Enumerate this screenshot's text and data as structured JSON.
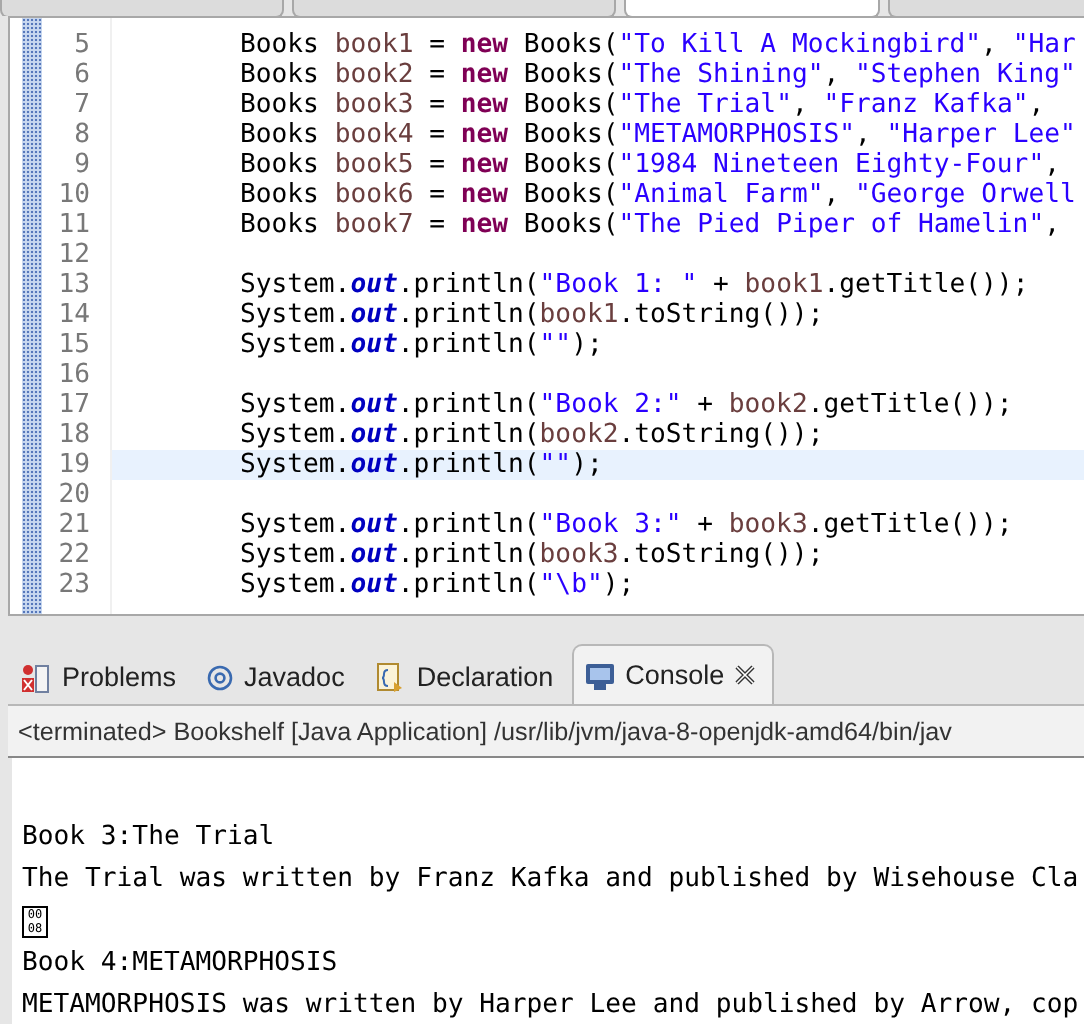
{
  "editor_tabs": [
    {
      "selected": false
    },
    {
      "selected": false
    },
    {
      "selected": true
    },
    {
      "selected": false
    }
  ],
  "editor": {
    "lines": [
      {
        "number": "5",
        "current": false,
        "tokens": [
          {
            "kind": "plain",
            "text": "Books "
          },
          {
            "kind": "var",
            "text": "book1"
          },
          {
            "kind": "plain",
            "text": " = "
          },
          {
            "kind": "keyword",
            "text": "new"
          },
          {
            "kind": "plain",
            "text": " Books("
          },
          {
            "kind": "string",
            "text": "\"To Kill A Mockingbird\""
          },
          {
            "kind": "plain",
            "text": ", "
          },
          {
            "kind": "string",
            "text": "\"Har"
          }
        ]
      },
      {
        "number": "6",
        "current": false,
        "tokens": [
          {
            "kind": "plain",
            "text": "Books "
          },
          {
            "kind": "var",
            "text": "book2"
          },
          {
            "kind": "plain",
            "text": " = "
          },
          {
            "kind": "keyword",
            "text": "new"
          },
          {
            "kind": "plain",
            "text": " Books("
          },
          {
            "kind": "string",
            "text": "\"The Shining\""
          },
          {
            "kind": "plain",
            "text": ", "
          },
          {
            "kind": "string",
            "text": "\"Stephen King\""
          }
        ]
      },
      {
        "number": "7",
        "current": false,
        "tokens": [
          {
            "kind": "plain",
            "text": "Books "
          },
          {
            "kind": "var",
            "text": "book3"
          },
          {
            "kind": "plain",
            "text": " = "
          },
          {
            "kind": "keyword",
            "text": "new"
          },
          {
            "kind": "plain",
            "text": " Books("
          },
          {
            "kind": "string",
            "text": "\"The Trial\""
          },
          {
            "kind": "plain",
            "text": ", "
          },
          {
            "kind": "string",
            "text": "\"Franz Kafka\""
          },
          {
            "kind": "plain",
            "text": ","
          }
        ]
      },
      {
        "number": "8",
        "current": false,
        "tokens": [
          {
            "kind": "plain",
            "text": "Books "
          },
          {
            "kind": "var",
            "text": "book4"
          },
          {
            "kind": "plain",
            "text": " = "
          },
          {
            "kind": "keyword",
            "text": "new"
          },
          {
            "kind": "plain",
            "text": " Books("
          },
          {
            "kind": "string",
            "text": "\"METAMORPHOSIS\""
          },
          {
            "kind": "plain",
            "text": ", "
          },
          {
            "kind": "string",
            "text": "\"Harper Lee\""
          }
        ]
      },
      {
        "number": "9",
        "current": false,
        "tokens": [
          {
            "kind": "plain",
            "text": "Books "
          },
          {
            "kind": "var",
            "text": "book5"
          },
          {
            "kind": "plain",
            "text": " = "
          },
          {
            "kind": "keyword",
            "text": "new"
          },
          {
            "kind": "plain",
            "text": " Books("
          },
          {
            "kind": "string",
            "text": "\"1984 Nineteen Eighty-Four\""
          },
          {
            "kind": "plain",
            "text": ","
          }
        ]
      },
      {
        "number": "10",
        "current": false,
        "tokens": [
          {
            "kind": "plain",
            "text": "Books "
          },
          {
            "kind": "var",
            "text": "book6"
          },
          {
            "kind": "plain",
            "text": " = "
          },
          {
            "kind": "keyword",
            "text": "new"
          },
          {
            "kind": "plain",
            "text": " Books("
          },
          {
            "kind": "string",
            "text": "\"Animal Farm\""
          },
          {
            "kind": "plain",
            "text": ", "
          },
          {
            "kind": "string",
            "text": "\"George Orwell"
          }
        ]
      },
      {
        "number": "11",
        "current": false,
        "tokens": [
          {
            "kind": "plain",
            "text": "Books "
          },
          {
            "kind": "var",
            "text": "book7"
          },
          {
            "kind": "plain",
            "text": " = "
          },
          {
            "kind": "keyword",
            "text": "new"
          },
          {
            "kind": "plain",
            "text": " Books("
          },
          {
            "kind": "string",
            "text": "\"The Pied Piper of Hamelin\""
          },
          {
            "kind": "plain",
            "text": ","
          }
        ]
      },
      {
        "number": "12",
        "current": false
      },
      {
        "number": "13",
        "current": false,
        "tokens": [
          {
            "kind": "plain",
            "text": "System."
          },
          {
            "kind": "field",
            "text": "out"
          },
          {
            "kind": "plain",
            "text": ".println("
          },
          {
            "kind": "string",
            "text": "\"Book 1: \""
          },
          {
            "kind": "plain",
            "text": " + "
          },
          {
            "kind": "var",
            "text": "book1"
          },
          {
            "kind": "plain",
            "text": ".getTitle());"
          }
        ]
      },
      {
        "number": "14",
        "current": false,
        "tokens": [
          {
            "kind": "plain",
            "text": "System."
          },
          {
            "kind": "field",
            "text": "out"
          },
          {
            "kind": "plain",
            "text": ".println("
          },
          {
            "kind": "var",
            "text": "book1"
          },
          {
            "kind": "plain",
            "text": ".toString());"
          }
        ]
      },
      {
        "number": "15",
        "current": false,
        "tokens": [
          {
            "kind": "plain",
            "text": "System."
          },
          {
            "kind": "field",
            "text": "out"
          },
          {
            "kind": "plain",
            "text": ".println("
          },
          {
            "kind": "string",
            "text": "\"\""
          },
          {
            "kind": "plain",
            "text": ");"
          }
        ]
      },
      {
        "number": "16",
        "current": false
      },
      {
        "number": "17",
        "current": false,
        "tokens": [
          {
            "kind": "plain",
            "text": "System."
          },
          {
            "kind": "field",
            "text": "out"
          },
          {
            "kind": "plain",
            "text": ".println("
          },
          {
            "kind": "string",
            "text": "\"Book 2:\""
          },
          {
            "kind": "plain",
            "text": " + "
          },
          {
            "kind": "var",
            "text": "book2"
          },
          {
            "kind": "plain",
            "text": ".getTitle());"
          }
        ]
      },
      {
        "number": "18",
        "current": false,
        "tokens": [
          {
            "kind": "plain",
            "text": "System."
          },
          {
            "kind": "field",
            "text": "out"
          },
          {
            "kind": "plain",
            "text": ".println("
          },
          {
            "kind": "var",
            "text": "book2"
          },
          {
            "kind": "plain",
            "text": ".toString());"
          }
        ]
      },
      {
        "number": "19",
        "current": true,
        "tokens": [
          {
            "kind": "plain",
            "text": "System."
          },
          {
            "kind": "field",
            "text": "out"
          },
          {
            "kind": "plain",
            "text": ".println("
          },
          {
            "kind": "string",
            "text": "\"\""
          },
          {
            "kind": "plain",
            "text": ");"
          }
        ]
      },
      {
        "number": "20",
        "current": false
      },
      {
        "number": "21",
        "current": false,
        "tokens": [
          {
            "kind": "plain",
            "text": "System."
          },
          {
            "kind": "field",
            "text": "out"
          },
          {
            "kind": "plain",
            "text": ".println("
          },
          {
            "kind": "string",
            "text": "\"Book 3:\""
          },
          {
            "kind": "plain",
            "text": " + "
          },
          {
            "kind": "var",
            "text": "book3"
          },
          {
            "kind": "plain",
            "text": ".getTitle());"
          }
        ]
      },
      {
        "number": "22",
        "current": false,
        "tokens": [
          {
            "kind": "plain",
            "text": "System."
          },
          {
            "kind": "field",
            "text": "out"
          },
          {
            "kind": "plain",
            "text": ".println("
          },
          {
            "kind": "var",
            "text": "book3"
          },
          {
            "kind": "plain",
            "text": ".toString());"
          }
        ]
      },
      {
        "number": "23",
        "current": false,
        "tokens": [
          {
            "kind": "plain",
            "text": "System."
          },
          {
            "kind": "field",
            "text": "out"
          },
          {
            "kind": "plain",
            "text": ".println("
          },
          {
            "kind": "string",
            "text": "\"\\b\""
          },
          {
            "kind": "plain",
            "text": ");"
          }
        ]
      }
    ]
  },
  "views": {
    "tabs": [
      {
        "label": "Problems",
        "kind": "problems",
        "selected": false
      },
      {
        "label": "Javadoc",
        "kind": "javadoc",
        "selected": false
      },
      {
        "label": "Declaration",
        "kind": "declaration",
        "selected": false
      },
      {
        "label": "Console",
        "kind": "console",
        "selected": true
      }
    ],
    "console": {
      "header": "<terminated> Bookshelf [Java Application] /usr/lib/jvm/java-8-openjdk-amd64/bin/jav",
      "lines": [
        {
          "kind": "text",
          "text": "Book 3:The Trial"
        },
        {
          "kind": "text",
          "text": "The Trial was written by Franz Kafka and published by Wisehouse Cla"
        },
        {
          "kind": "glyph",
          "code": "0008"
        },
        {
          "kind": "text",
          "text": "Book 4:METAMORPHOSIS"
        },
        {
          "kind": "text",
          "text": "METAMORPHOSIS was written by Harper Lee and published by Arrow, cop"
        }
      ]
    }
  }
}
